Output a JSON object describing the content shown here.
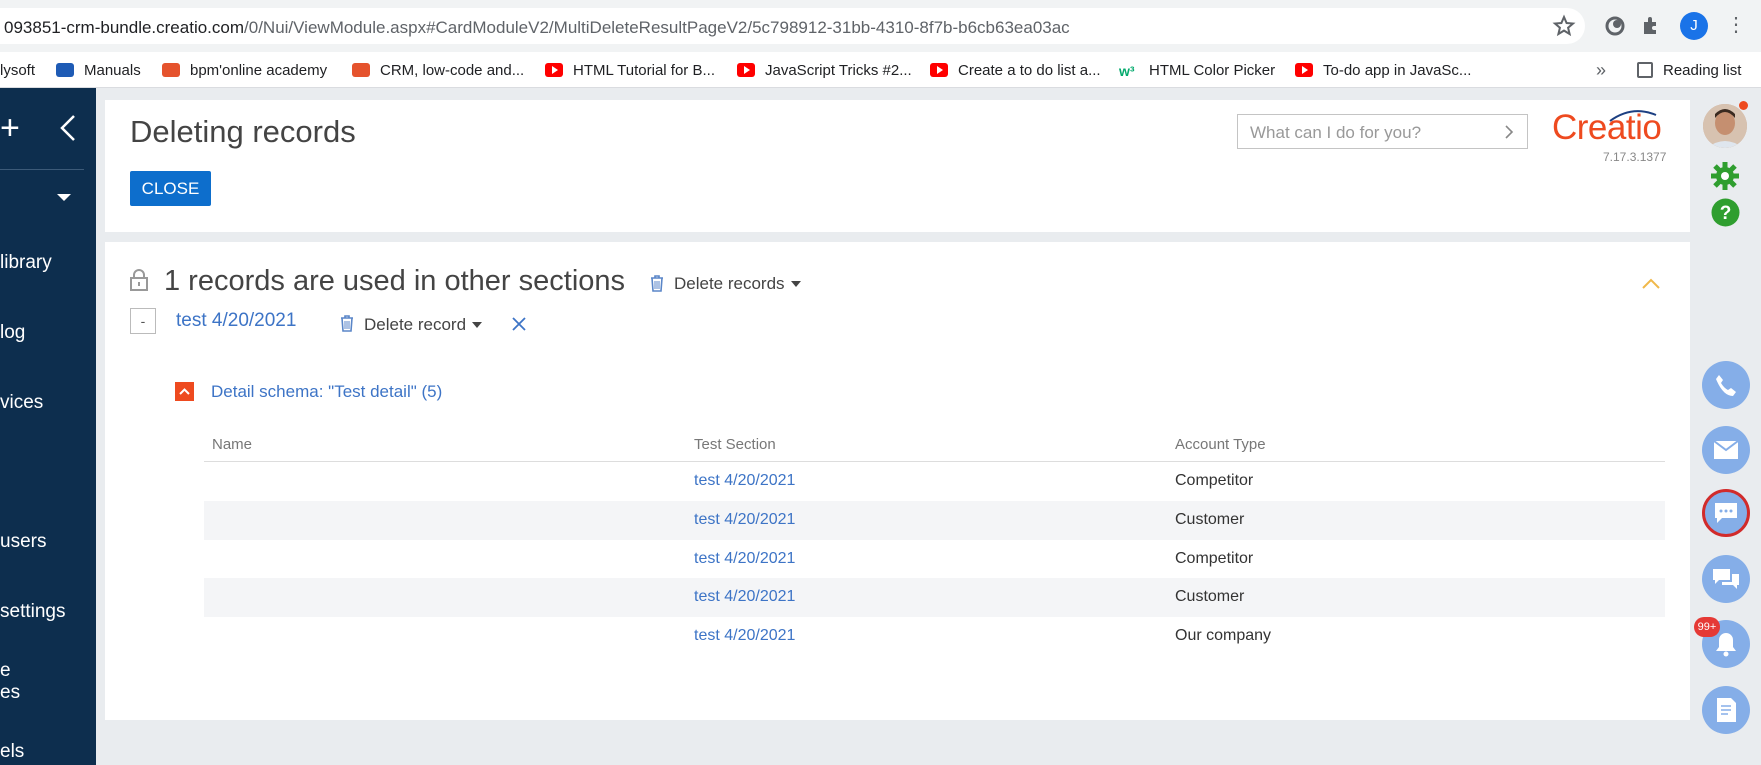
{
  "browser": {
    "url_host": "093851-crm-bundle.creatio.com",
    "url_path": "/0/Nui/ViewModule.aspx#CardModuleV2/MultiDeleteResultPageV2/5c798912-31bb-4310-8f7b-b6cb63ea03ac",
    "profile_initial": "J",
    "bookmarks": [
      {
        "label": "lysoft",
        "icon": "none"
      },
      {
        "label": "Manuals",
        "icon": "blue"
      },
      {
        "label": "bpm'online academy",
        "icon": "bpm"
      },
      {
        "label": "CRM, low-code and...",
        "icon": "bpm"
      },
      {
        "label": "HTML Tutorial for B...",
        "icon": "yt"
      },
      {
        "label": "JavaScript Tricks #2...",
        "icon": "yt"
      },
      {
        "label": "Create a to do list a...",
        "icon": "yt"
      },
      {
        "label": "HTML Color Picker",
        "icon": "w3"
      },
      {
        "label": "To-do app in JavaSc...",
        "icon": "yt"
      }
    ],
    "more_label": "»",
    "reading_list": "Reading list"
  },
  "nav": {
    "items": [
      "library",
      "log",
      "vices",
      "users",
      "settings",
      "e",
      "es",
      "els"
    ]
  },
  "header": {
    "title": "Deleting records",
    "close_label": "CLOSE",
    "search_placeholder": "What can I do for you?",
    "logo": "Creatio",
    "version": "7.17.3.1377"
  },
  "section": {
    "title": "1 records are used in other sections",
    "delete_records_label": "Delete records",
    "minus_label": "-",
    "record_name": "test 4/20/2021",
    "delete_record_label": "Delete record",
    "detail_title": "Detail schema: \"Test detail\" (5)",
    "columns": [
      "Name",
      "Test Section",
      "Account Type"
    ],
    "rows": [
      {
        "name": "",
        "section": "test 4/20/2021",
        "type": "Competitor"
      },
      {
        "name": "",
        "section": "test 4/20/2021",
        "type": "Customer"
      },
      {
        "name": "",
        "section": "test 4/20/2021",
        "type": "Competitor"
      },
      {
        "name": "",
        "section": "test 4/20/2021",
        "type": "Customer"
      },
      {
        "name": "",
        "section": "test 4/20/2021",
        "type": "Our company"
      }
    ]
  },
  "rail": {
    "notification_count": "99+"
  },
  "colors": {
    "nav_bg": "#0d2e4e",
    "primary_button": "#0d6ecc",
    "brand": "#ee4a1f",
    "link": "#3d74c6"
  }
}
